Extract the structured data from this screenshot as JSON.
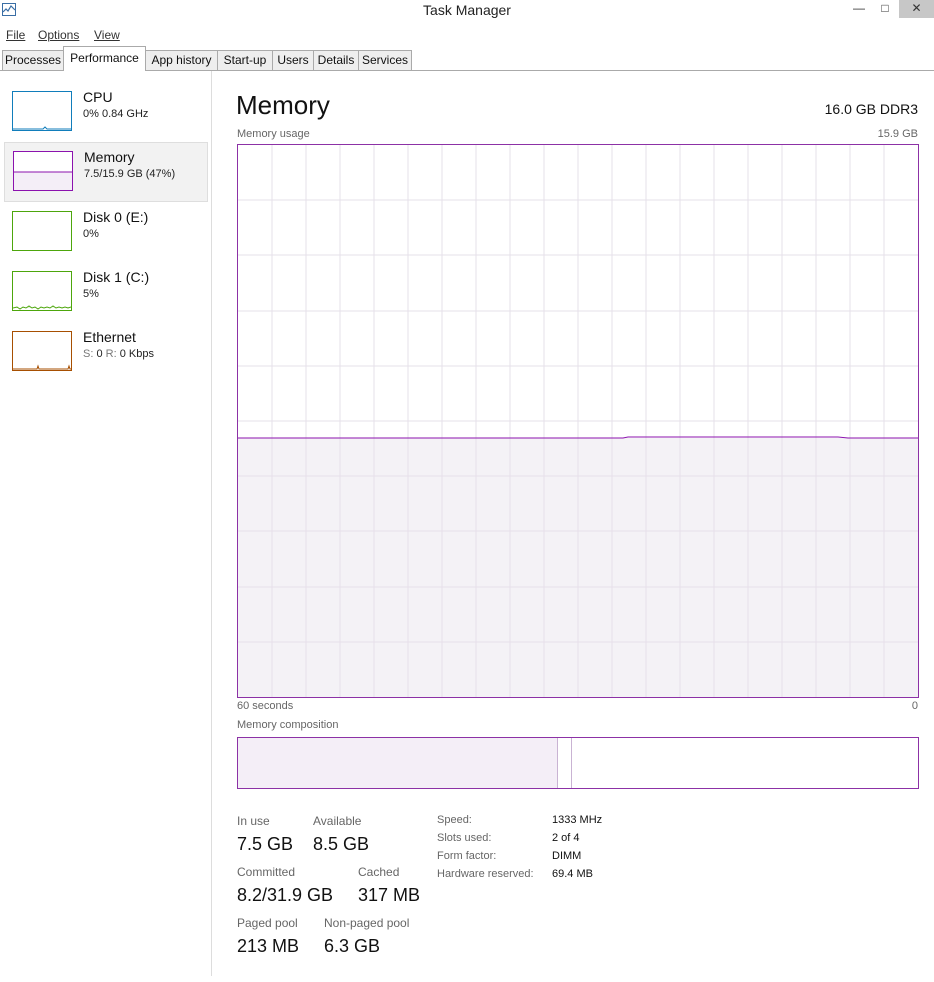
{
  "window": {
    "title": "Task Manager",
    "min_glyph": "—",
    "max_glyph": "□",
    "close_glyph": "✕"
  },
  "menu": {
    "file": "File",
    "options": "Options",
    "view": "View"
  },
  "tabs": [
    "Processes",
    "Performance",
    "App history",
    "Start-up",
    "Users",
    "Details",
    "Services"
  ],
  "active_tab": "Performance",
  "sidebar": {
    "cpu": {
      "name": "CPU",
      "value": "0% 0.84 GHz",
      "color": "#117dbb"
    },
    "memory": {
      "name": "Memory",
      "value": "7.5/15.9 GB (47%)",
      "color": "#8b12ae"
    },
    "disk0": {
      "name": "Disk 0 (E:)",
      "value": "0%",
      "color": "#4da60c"
    },
    "disk1": {
      "name": "Disk 1 (C:)",
      "value": "5%",
      "color": "#4da60c"
    },
    "ethernet": {
      "name": "Ethernet",
      "send_label": "S:",
      "send_value": "0",
      "recv_label": "R:",
      "recv_value": "0 Kbps",
      "color": "#a74f01"
    }
  },
  "main": {
    "title": "Memory",
    "spec": "16.0 GB DDR3",
    "usage_label": "Memory usage",
    "usage_max": "15.9 GB",
    "time_left": "60 seconds",
    "time_right": "0",
    "composition_label": "Memory composition",
    "usage_percent": 47,
    "composition": {
      "in_use_fraction": 0.47,
      "modified_fraction": 0.02
    }
  },
  "stats": {
    "in_use": {
      "label": "In use",
      "value": "7.5 GB"
    },
    "available": {
      "label": "Available",
      "value": "8.5 GB"
    },
    "committed": {
      "label": "Committed",
      "value": "8.2/31.9 GB"
    },
    "cached": {
      "label": "Cached",
      "value": "317 MB"
    },
    "paged_pool": {
      "label": "Paged pool",
      "value": "213 MB"
    },
    "non_paged_pool": {
      "label": "Non-paged pool",
      "value": "6.3 GB"
    }
  },
  "details": [
    {
      "label": "Speed:",
      "value": "1333 MHz"
    },
    {
      "label": "Slots used:",
      "value": "2 of 4"
    },
    {
      "label": "Form factor:",
      "value": "DIMM"
    },
    {
      "label": "Hardware reserved:",
      "value": "69.4 MB"
    }
  ]
}
